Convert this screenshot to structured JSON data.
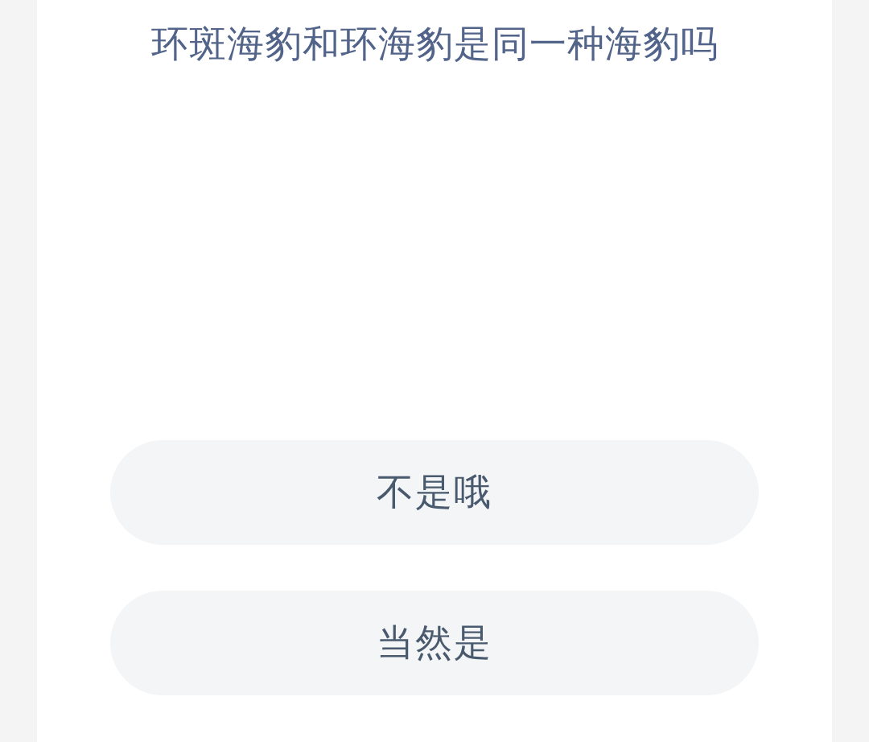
{
  "question": "环斑海豹和环海豹是同一种海豹吗",
  "options": [
    {
      "label": "不是哦"
    },
    {
      "label": "当然是"
    }
  ]
}
